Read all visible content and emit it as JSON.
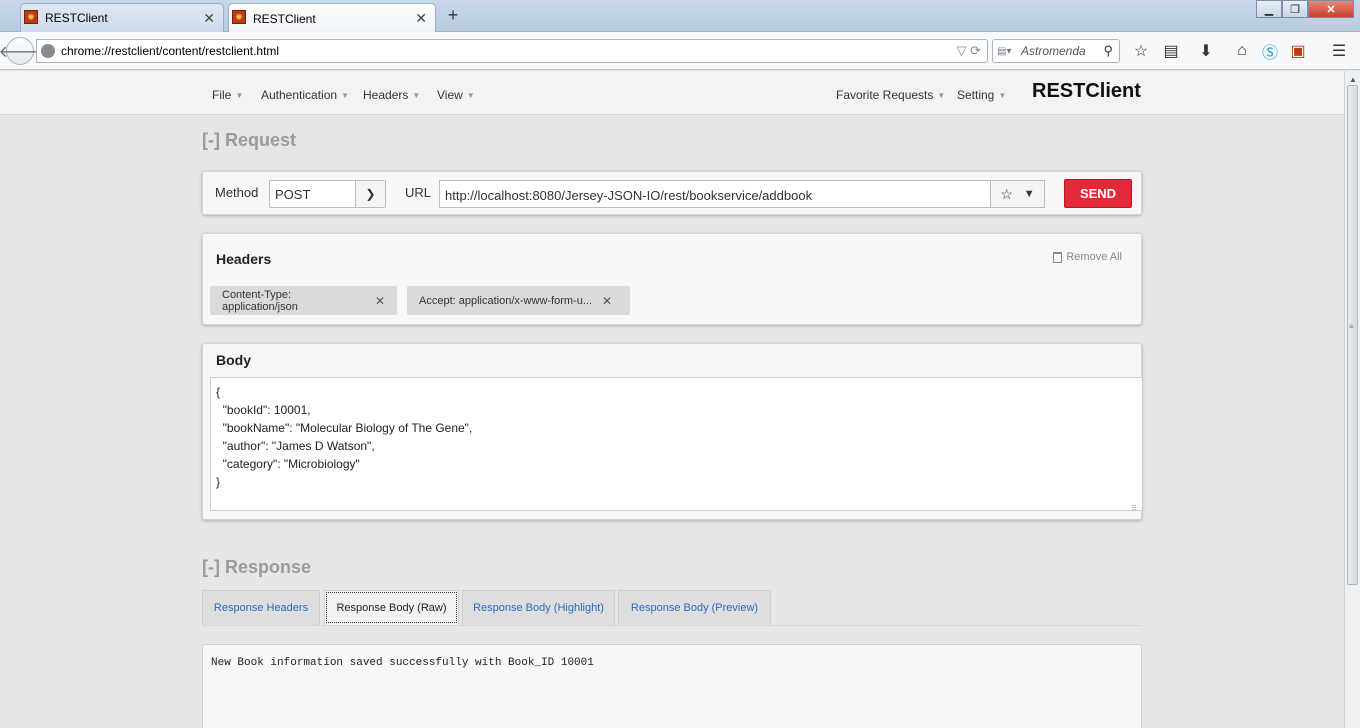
{
  "browser": {
    "tabs": [
      {
        "title": "RESTClient",
        "active": false
      },
      {
        "title": "RESTClient",
        "active": true
      }
    ],
    "address": "chrome://restclient/content/restclient.html",
    "search_placeholder": "Astromenda"
  },
  "menu": {
    "left": [
      "File",
      "Authentication",
      "Headers",
      "View"
    ],
    "right": [
      "Favorite Requests",
      "Setting"
    ],
    "brand": "RESTClient"
  },
  "request": {
    "section_title": "[-] Request",
    "method_label": "Method",
    "method_value": "POST",
    "url_label": "URL",
    "url_value": "http://localhost:8080/Jersey-JSON-IO/rest/bookservice/addbook",
    "send_label": "SEND"
  },
  "headers": {
    "title": "Headers",
    "remove_all": "Remove All",
    "items": [
      "Content-Type: application/json",
      "Accept: application/x-www-form-u..."
    ]
  },
  "body": {
    "title": "Body",
    "content": "{\n  \"bookId\": 10001,\n  \"bookName\": \"Molecular Biology of The Gene\",\n  \"author\": \"James D Watson\",\n  \"category\": \"Microbiology\"\n}"
  },
  "response": {
    "section_title": "[-] Response",
    "tabs": [
      {
        "label": "Response Headers",
        "active": false
      },
      {
        "label": "Response Body (Raw)",
        "active": true
      },
      {
        "label": "Response Body (Highlight)",
        "active": false
      },
      {
        "label": "Response Body (Preview)",
        "active": false
      }
    ],
    "body_text": "New Book information saved successfully with Book_ID 10001"
  },
  "colors": {
    "send_button": "#e3283a",
    "tab_link": "#2a6ac2",
    "section_title": "#9a9a9a"
  }
}
